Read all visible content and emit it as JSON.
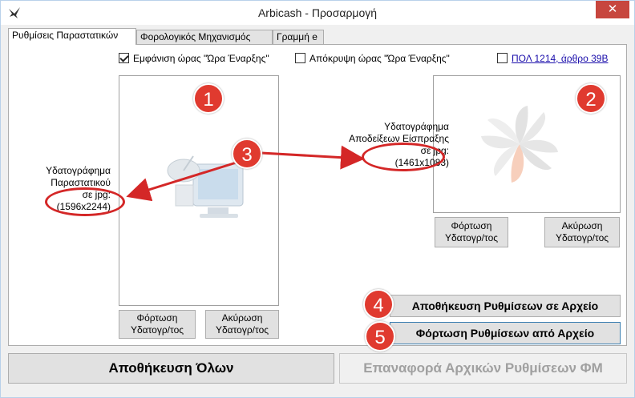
{
  "window": {
    "title": "Arbicash - Προσαρμογή",
    "close_glyph": "✕",
    "app_icon": "bird-icon"
  },
  "tabs": [
    {
      "label": "Ρυθμίσεις Παραστατικών"
    },
    {
      "label": "Φορολογικός Μηχανισμός"
    },
    {
      "label": "Γραμμή e"
    }
  ],
  "checks": {
    "show_time": "Εμφάνιση ώρας \"Ώρα Έναρξης\"",
    "hide_time": "Απόκρυψη ώρας \"Ώρα Έναρξης\"",
    "pol_link": "ΠΟΛ 1214, άρθρο 39Β"
  },
  "left_watermark": {
    "line1": "Υδατογράφημα",
    "line2": "Παραστατικού",
    "line3": "σε jpg:",
    "line4": "(1596x2244)",
    "load_button": "Φόρτωση\nΥδατογρ/τος",
    "cancel_button": "Ακύρωση\nΥδατογρ/τος"
  },
  "right_watermark": {
    "line1": "Υδατογράφημα",
    "line2": "Αποδείξεων Είσπραξης",
    "line3": "σε jpg:",
    "line4": "(1461x1083)",
    "load_button": "Φόρτωση\nΥδατογρ/τος",
    "cancel_button": "Ακύρωση\nΥδατογρ/τος"
  },
  "actions": {
    "save_file": "Αποθήκευση Ρυθμίσεων σε Αρχείο",
    "load_file": "Φόρτωση Ρυθμίσεων από Αρχείο",
    "save_all": "Αποθήκευση Όλων",
    "restore_defaults": "Επαναφορά Αρχικών Ρυθμίσεων ΦΜ"
  },
  "markers": [
    "1",
    "2",
    "3",
    "4",
    "5"
  ],
  "colors": {
    "marker": "#e03a2f",
    "close": "#c7463e",
    "link": "#1a0dab"
  }
}
